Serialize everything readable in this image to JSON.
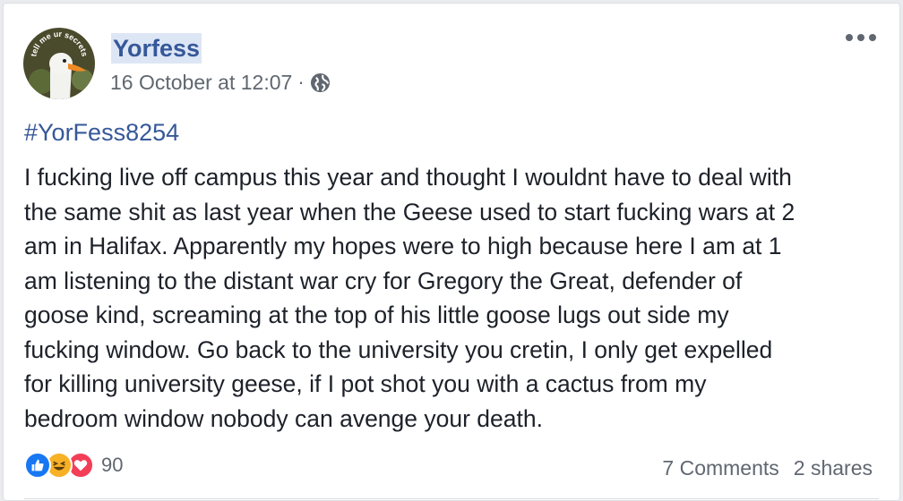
{
  "post": {
    "author": "Yorfess",
    "avatar_text": "tell me ur secrets",
    "timestamp": "16 October at 12:07",
    "separator": "·",
    "privacy_icon": "globe-icon",
    "more_icon": "more-options-icon",
    "hashtag": "#YorFess8254",
    "body": "I fucking live off campus this year and thought I wouldnt have to deal with\nthe same shit as last year when the Geese used to start fucking wars at 2\nam in Halifax. Apparently my hopes were to high because here I am at 1\nam listening to the distant war cry for Gregory the Great, defender of\ngoose kind, screaming at the top of his little goose lugs out side my\nfucking window. Go back to the university you cretin, I only get expelled\nfor killing university geese, if I pot shot you with a cactus from my\nbedroom window nobody can avenge your death."
  },
  "reactions": {
    "icons": [
      "like-icon",
      "haha-icon",
      "love-icon"
    ],
    "count": "90"
  },
  "footer": {
    "comments": "7 Comments",
    "shares": "2 shares"
  },
  "colors": {
    "link": "#365899",
    "muted": "#606770",
    "like": "#1877f2",
    "haha": "#f7b125",
    "love": "#f33e58"
  }
}
